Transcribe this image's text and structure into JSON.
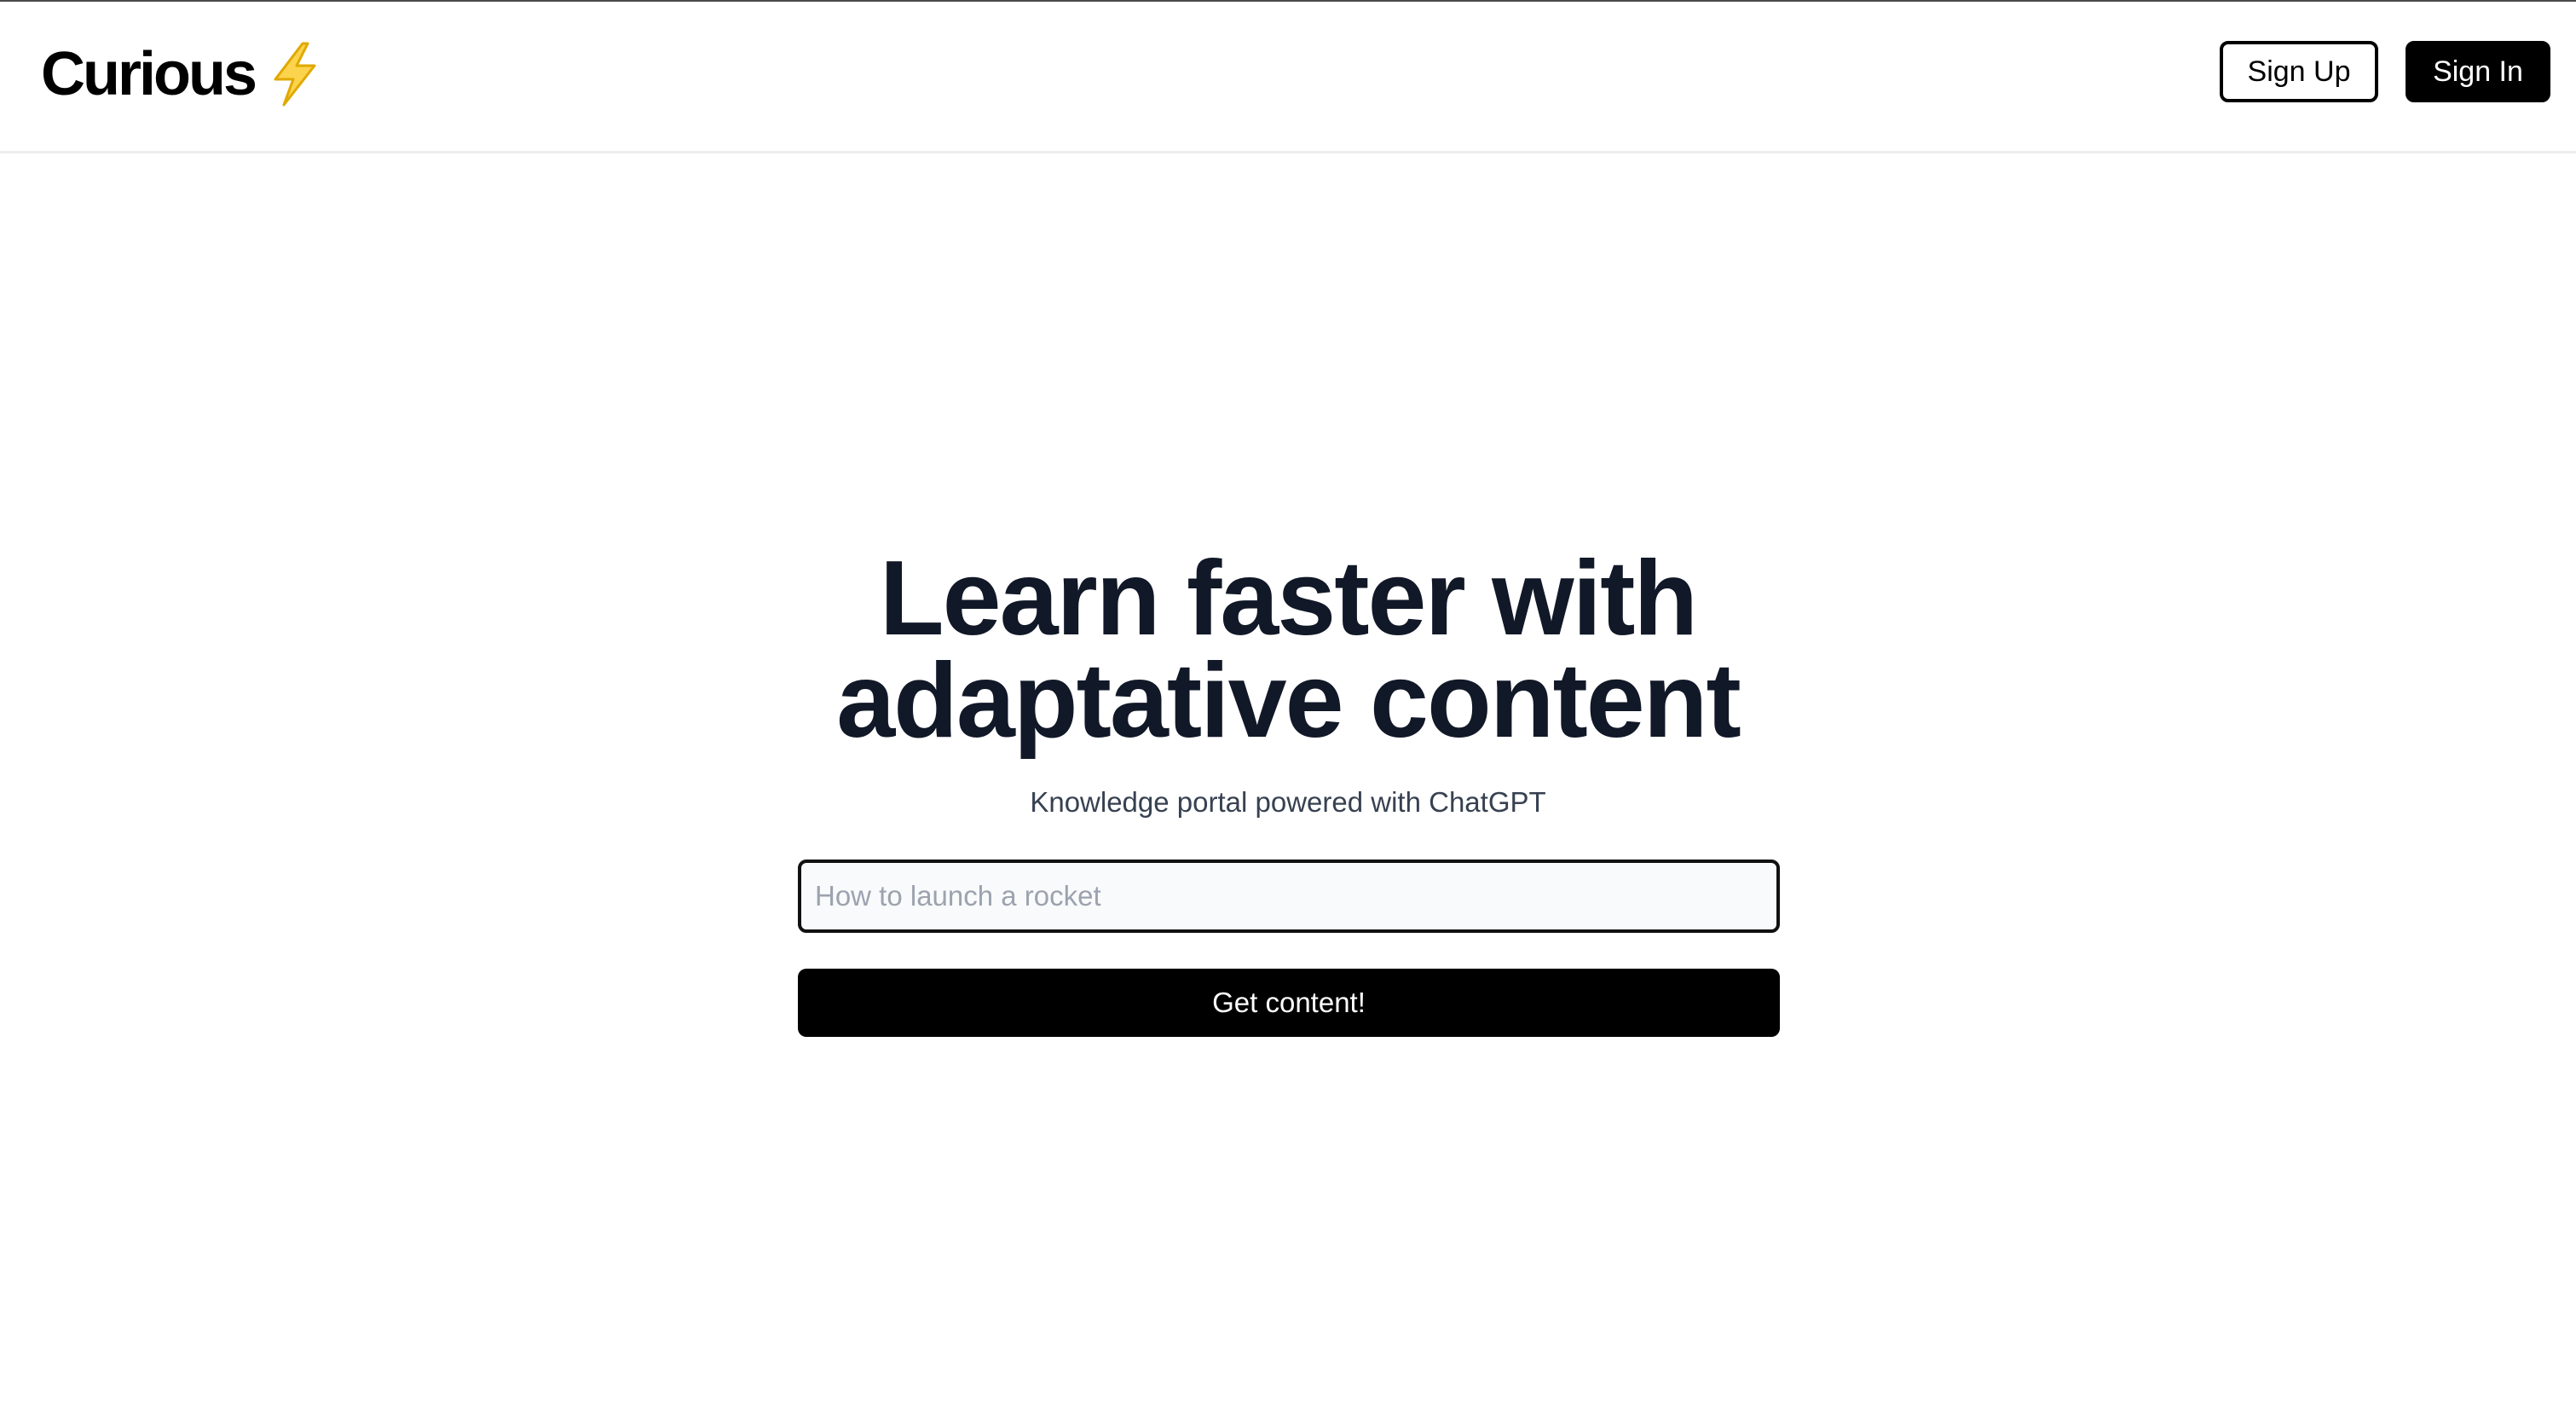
{
  "header": {
    "brand_name": "Curious",
    "brand_icon": "lightning-bolt-icon",
    "sign_up_label": "Sign Up",
    "sign_in_label": "Sign In"
  },
  "hero": {
    "title_line_1": "Learn faster with",
    "title_line_2": "adaptative content",
    "subtitle": "Knowledge portal powered with ChatGPT",
    "search": {
      "placeholder": "How to launch a rocket",
      "value": ""
    },
    "submit_label": "Get content!"
  },
  "colors": {
    "background": "#ffffff",
    "primary": "#000000",
    "title_text": "#111827",
    "subtitle_text": "#374151",
    "input_background": "#f9fafb",
    "placeholder": "#9ca3af",
    "bolt_fill": "#fcd34d",
    "bolt_stroke": "#e0a800"
  }
}
